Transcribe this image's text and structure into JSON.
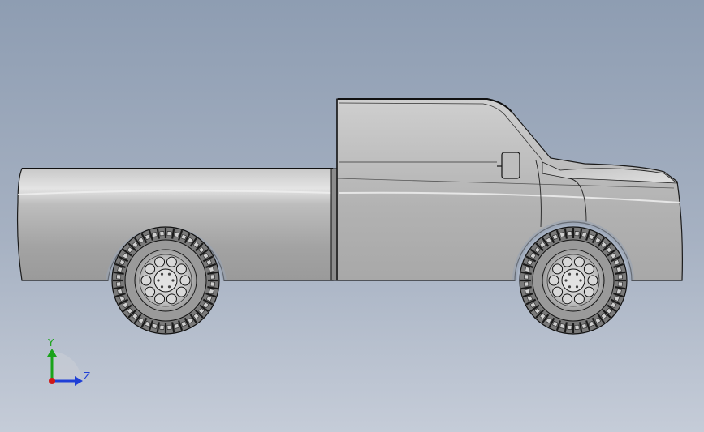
{
  "viewport": {
    "model": "pickup-truck",
    "view": "side"
  },
  "triad": {
    "y_label": "Y",
    "z_label": "Z",
    "colors": {
      "y_axis": "#1aa31a",
      "z_axis": "#1f3fd6",
      "x_axis": "#d01818"
    }
  },
  "colors": {
    "body_light": "#dcdcdc",
    "body_mid": "#b4b4b4",
    "body_dark": "#8a8a8a",
    "outline": "#1a1a1a",
    "tire": "#6a6a6a"
  }
}
